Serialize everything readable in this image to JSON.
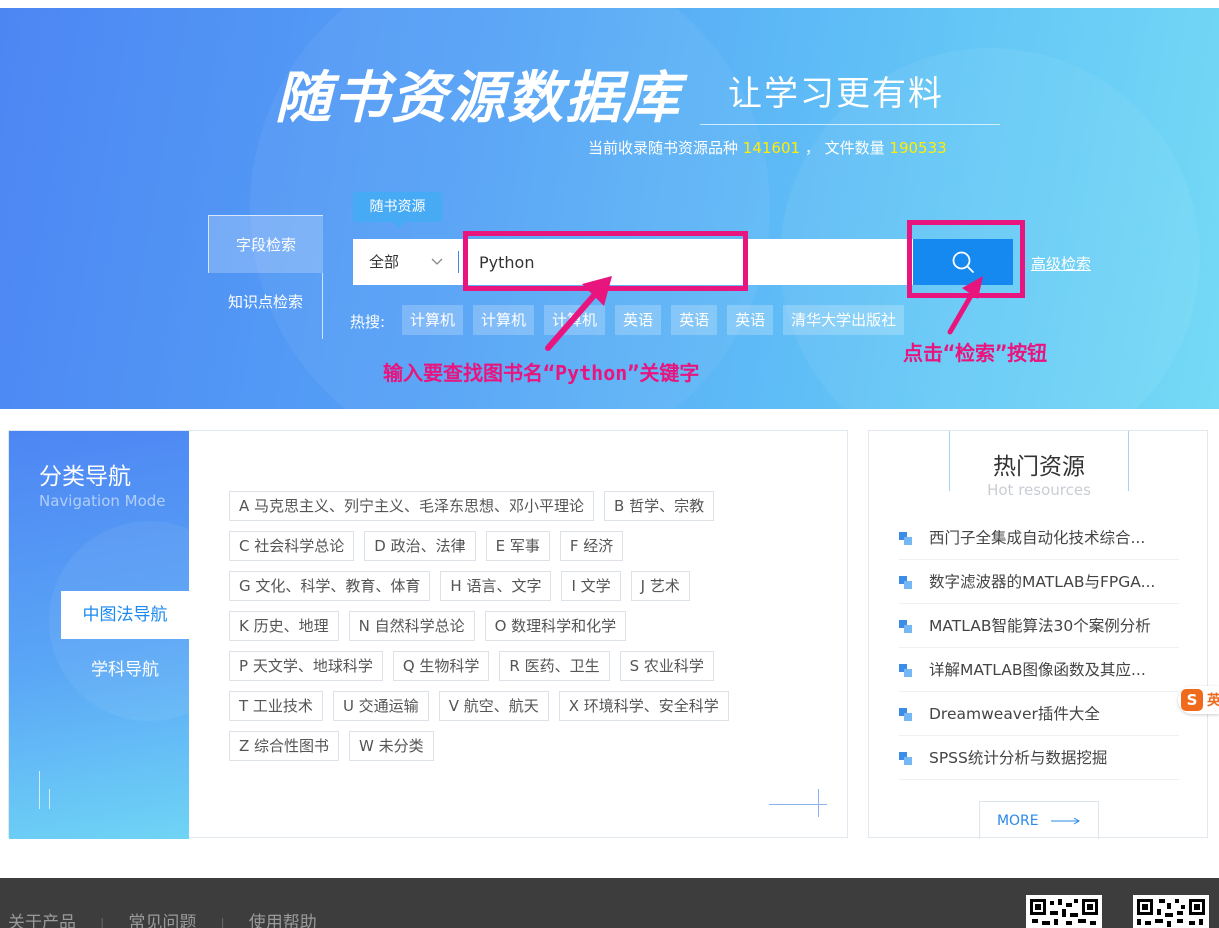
{
  "banner": {
    "title": "随书资源数据库",
    "slogan": "让学习更有料",
    "stats_prefix": "当前收录随书资源品种",
    "book_count": "141601",
    "stats_middle": "，  文件数量",
    "file_count": "190533"
  },
  "search": {
    "tabs": [
      "字段检索",
      "知识点检索"
    ],
    "type_label": "随书资源",
    "scope": "全部",
    "query": "Python",
    "advanced_label": "高级检索",
    "hot_label": "热搜:",
    "hot_tags": [
      "计算机",
      "计算机",
      "计算机",
      "英语",
      "英语",
      "英语",
      "清华大学出版社"
    ]
  },
  "annotations": {
    "input_note": "输入要查找图书名“Python”关键字",
    "button_note": "点击“检索”按钮",
    "color": "#e9157f"
  },
  "category_nav": {
    "title": "分类导航",
    "subtitle": "Navigation Mode",
    "nav_items": [
      "中图法导航",
      "学科导航"
    ],
    "rows": [
      [
        "A 马克思主义、列宁主义、毛泽东思想、邓小平理论",
        "B 哲学、宗教"
      ],
      [
        "C 社会科学总论",
        "D 政治、法律",
        "E 军事",
        "F 经济"
      ],
      [
        "G 文化、科学、教育、体育",
        "H 语言、文字",
        "I 文学",
        "J 艺术"
      ],
      [
        "K 历史、地理",
        "N 自然科学总论",
        "O 数理科学和化学"
      ],
      [
        "P 天文学、地球科学",
        "Q 生物科学",
        "R 医药、卫生",
        "S 农业科学"
      ],
      [
        "T 工业技术",
        "U 交通运输",
        "V 航空、航天",
        "X 环境科学、安全科学"
      ],
      [
        "Z 综合性图书",
        "W 未分类"
      ]
    ]
  },
  "hot_resources": {
    "title": "热门资源",
    "subtitle": "Hot resources",
    "items": [
      "西门子全集成自动化技术综合...",
      "数字滤波器的MATLAB与FPGA...",
      "MATLAB智能算法30个案例分析",
      "详解MATLAB图像函数及其应...",
      "Dreamweaver插件大全",
      "SPSS统计分析与数据挖掘"
    ],
    "more_label": "MORE"
  },
  "footer": {
    "links": [
      "关于产品",
      "常见问题",
      "使用帮助"
    ]
  },
  "ime": {
    "s": "S",
    "e": "英"
  },
  "colors": {
    "accent": "#1689f1",
    "highlight": "#ffee00",
    "annotation": "#e9157f",
    "footer_bg": "#3d3d3d"
  }
}
